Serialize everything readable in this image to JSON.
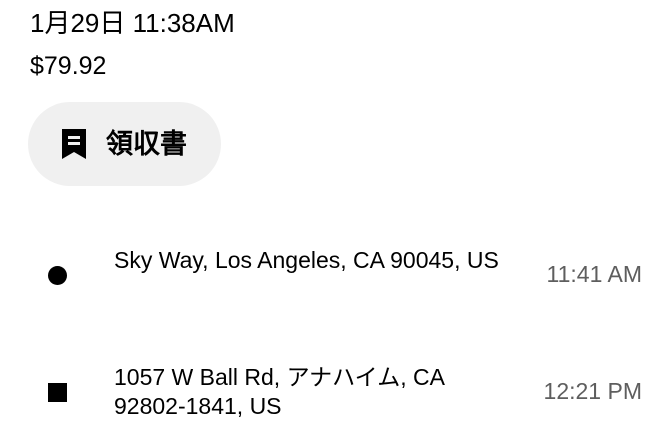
{
  "trip": {
    "datetime": "1月29日 11:38AM",
    "fare": "$79.92"
  },
  "receipt_button": {
    "label": "領収書",
    "icon": "receipt-icon"
  },
  "stops": {
    "pickup": {
      "marker": "circle",
      "address": "Sky Way, Los Angeles, CA 90045, US",
      "time": "11:41 AM"
    },
    "dropoff": {
      "marker": "square",
      "address": "1057 W Ball Rd, アナハイム, CA 92802-1841, US",
      "time": "12:21 PM"
    }
  },
  "colors": {
    "text": "#000000",
    "secondary_text": "#5e5e5e",
    "button_background": "#f0f0f0"
  }
}
